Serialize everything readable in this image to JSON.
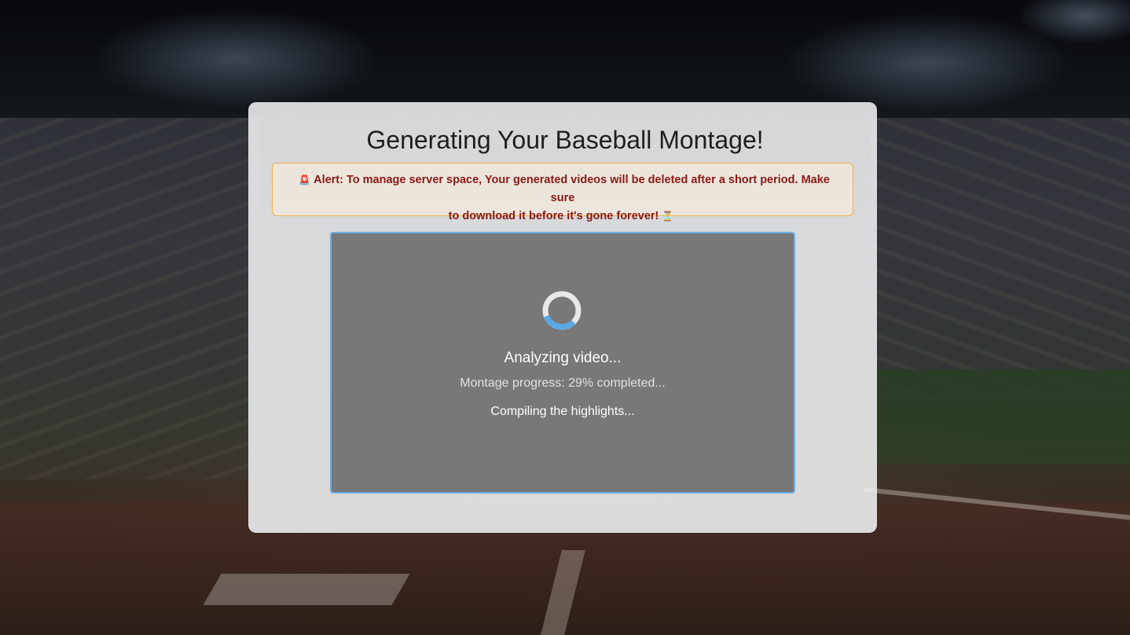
{
  "page": {
    "title": "Generating Your Baseball Montage!"
  },
  "alert": {
    "icon_left": "🚨",
    "text_line1": "Alert: To manage server space, Your generated videos will be deleted after a short period. Make sure",
    "text_line2": "to download it before it's gone forever!",
    "icon_right": "⏳"
  },
  "status": {
    "main": "Analyzing video...",
    "progress": "Montage progress: 29% completed...",
    "progress_percent": 29,
    "step": "Compiling the highlights..."
  },
  "colors": {
    "accent": "#6aaee6",
    "alert_text": "#8a1a14",
    "alert_border": "#f0b04a",
    "player_bg": "#787878"
  },
  "icons": {
    "spinner": "loading-spinner-icon",
    "alert": "siren-icon",
    "hourglass": "hourglass-icon"
  }
}
